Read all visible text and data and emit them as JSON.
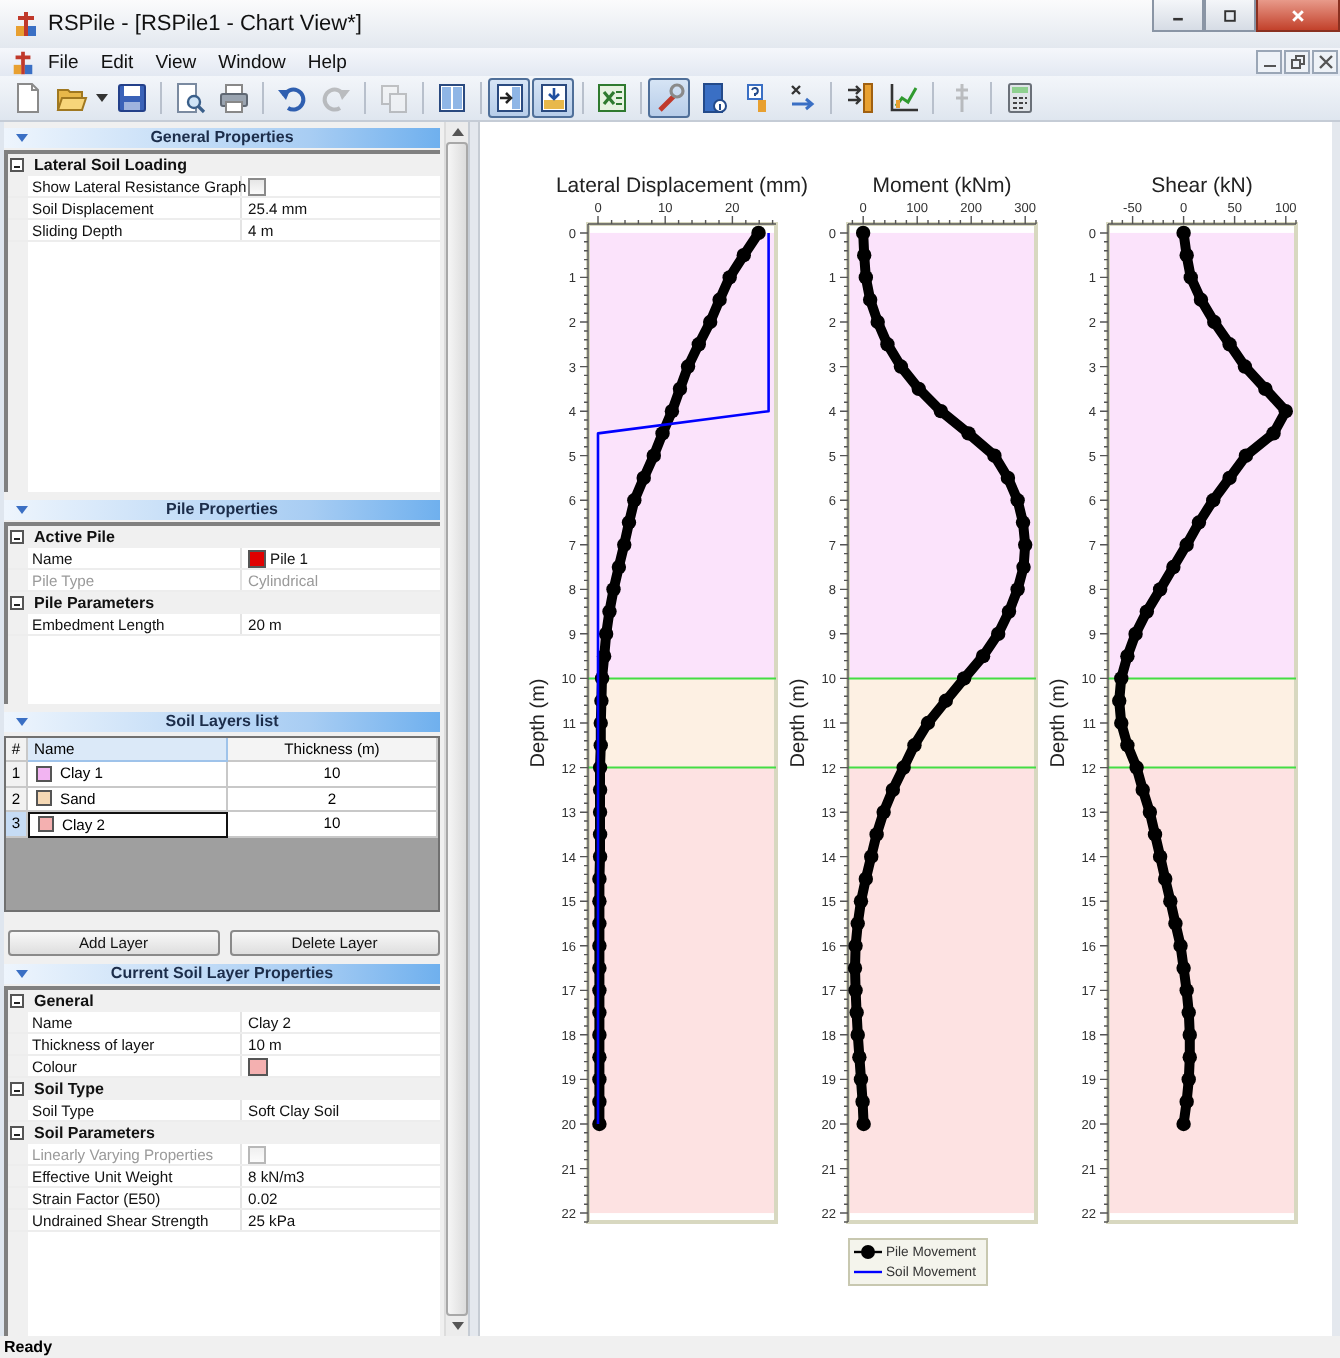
{
  "window": {
    "title": "RSPile - [RSPile1 - Chart View*]"
  },
  "menu": [
    "File",
    "Edit",
    "View",
    "Window",
    "Help"
  ],
  "toolbar": [
    {
      "pressed": false,
      "disabled": false
    },
    {
      "pressed": false,
      "disabled": false
    },
    {
      "pressed": false,
      "disabled": false
    },
    {
      "pressed": false,
      "disabled": false
    },
    {
      "pressed": false,
      "disabled": false
    },
    {
      "pressed": false,
      "disabled": false
    },
    {
      "pressed": false,
      "disabled": true
    },
    {
      "pressed": false,
      "disabled": true
    },
    {
      "pressed": false,
      "disabled": false
    },
    {
      "pressed": true,
      "disabled": false
    },
    {
      "pressed": true,
      "disabled": false
    },
    {
      "pressed": false,
      "disabled": false
    },
    {
      "pressed": true,
      "disabled": false
    },
    {
      "pressed": false,
      "disabled": false
    },
    {
      "pressed": false,
      "disabled": false
    },
    {
      "pressed": false,
      "disabled": false
    },
    {
      "pressed": false,
      "disabled": false
    },
    {
      "pressed": false,
      "disabled": false
    },
    {
      "pressed": false,
      "disabled": true
    },
    {
      "pressed": false,
      "disabled": false
    }
  ],
  "left_panel": [
    {
      "kind": "properties",
      "title": "General Properties",
      "categories": [
        {
          "name": "Lateral Soil Loading",
          "expanded": true,
          "rows": [
            {
              "kind": "checkbox",
              "label": "Show Lateral Resistance Graph",
              "checked": false,
              "disabled": false
            },
            {
              "kind": "text",
              "label": "Soil Displacement",
              "value": "25.4 mm",
              "disabled": false
            },
            {
              "kind": "text",
              "label": "Sliding Depth",
              "value": "4 m",
              "disabled": false
            }
          ]
        }
      ]
    },
    {
      "kind": "properties",
      "title": "Pile Properties",
      "categories": [
        {
          "name": "Active Pile",
          "expanded": true,
          "rows": [
            {
              "kind": "swatch_text",
              "label": "Name",
              "value": "Pile 1",
              "color": "#e00000",
              "disabled": false
            },
            {
              "kind": "text",
              "label": "Pile Type",
              "value": "Cylindrical",
              "disabled": true
            }
          ]
        },
        {
          "name": "Pile Parameters",
          "expanded": true,
          "rows": [
            {
              "kind": "text",
              "label": "Embedment Length",
              "value": "20 m",
              "disabled": false
            }
          ]
        }
      ]
    },
    {
      "kind": "table",
      "title": "Soil Layers list",
      "columns": [
        {
          "label": "#",
          "selected": false
        },
        {
          "label": "Name",
          "selected": true
        },
        {
          "label": "Thickness (m)",
          "selected": false
        }
      ],
      "rows": [
        {
          "index": "1",
          "name": "Clay 1",
          "thickness": "10",
          "color": "#f2b4f2",
          "selected": false
        },
        {
          "index": "2",
          "name": "Sand",
          "thickness": "2",
          "color": "#f5d8b4",
          "selected": false
        },
        {
          "index": "3",
          "name": "Clay 2",
          "thickness": "10",
          "color": "#f4b0b0",
          "selected": true
        }
      ]
    },
    {
      "kind": "buttons",
      "buttons": [
        "Add Layer",
        "Delete Layer"
      ]
    },
    {
      "kind": "properties",
      "title": "Current Soil Layer Properties",
      "categories": [
        {
          "name": "General",
          "expanded": true,
          "rows": [
            {
              "kind": "text",
              "label": "Name",
              "value": "Clay 2",
              "disabled": false
            },
            {
              "kind": "text",
              "label": "Thickness of layer",
              "value": "10 m",
              "disabled": false
            },
            {
              "kind": "swatch",
              "label": "Colour",
              "color": "#f4b0b0",
              "disabled": false
            }
          ]
        },
        {
          "name": "Soil Type",
          "expanded": true,
          "rows": [
            {
              "kind": "text",
              "label": "Soil Type",
              "value": "Soft Clay Soil",
              "disabled": false
            }
          ]
        },
        {
          "name": "Soil Parameters",
          "expanded": true,
          "rows": [
            {
              "kind": "checkbox",
              "label": "Linearly Varying Properties",
              "checked": false,
              "disabled": true
            },
            {
              "kind": "text",
              "label": "Effective Unit Weight",
              "value": "8 kN/m3",
              "disabled": false
            },
            {
              "kind": "text",
              "label": "Strain Factor (E50)",
              "value": "0.02",
              "disabled": false
            },
            {
              "kind": "text",
              "label": "Undrained Shear Strength",
              "value": "25 kPa",
              "disabled": false
            }
          ]
        }
      ]
    }
  ],
  "charts": [
    {
      "chart_data": {
        "type": "line",
        "orientation": "horizontal",
        "title": "Lateral Displacement (mm)",
        "ylabel": "Depth (m)",
        "x": [
          0,
          0.5,
          1,
          1.5,
          2,
          2.5,
          3,
          3.5,
          4,
          4.5,
          5,
          5.5,
          6,
          6.5,
          7,
          7.5,
          8,
          8.5,
          9,
          9.5,
          10,
          10.5,
          11,
          11.5,
          12,
          12.5,
          13,
          13.5,
          14,
          14.5,
          15,
          15.5,
          16,
          16.5,
          17,
          17.5,
          18,
          18.5,
          19,
          19.5,
          20
        ],
        "xlim": [
          -1.5,
          26.5
        ],
        "xticks": [
          0,
          10,
          20
        ],
        "ylim": [
          22.2,
          -0.2
        ],
        "bands": [
          {
            "axis": "y",
            "from": 0,
            "to": 10,
            "color": "#fbe3fb"
          },
          {
            "axis": "y",
            "from": 10,
            "to": 12,
            "color": "#fdf0e3"
          },
          {
            "axis": "y",
            "from": 12,
            "to": 22,
            "color": "#fde2e2"
          }
        ],
        "ref_lines": [
          {
            "axis": "y",
            "value": 10,
            "color": "#44dd44"
          },
          {
            "axis": "y",
            "value": 12,
            "color": "#44dd44"
          }
        ],
        "yticks": [
          0,
          1,
          2,
          3,
          4,
          5,
          6,
          7,
          8,
          9,
          10,
          11,
          12,
          13,
          14,
          15,
          16,
          17,
          18,
          19,
          20,
          21,
          22
        ],
        "series": [
          {
            "name": "Pile Movement",
            "color": "#000000",
            "marker": "circle",
            "values": [
              23.9,
              21.7,
              19.6,
              18.1,
              16.7,
              15.0,
              13.4,
              12.2,
              11.0,
              9.6,
              8.3,
              6.8,
              5.4,
              4.6,
              3.9,
              3.1,
              2.3,
              1.7,
              1.2,
              0.9,
              0.6,
              0.5,
              0.4,
              0.4,
              0.3,
              0.3,
              0.3,
              0.3,
              0.3,
              0.2,
              0.2,
              0.2,
              0.2,
              0.2,
              0.2,
              0.2,
              0.2,
              0.2,
              0.2,
              0.2,
              0.2
            ]
          },
          {
            "name": "Soil Movement",
            "color": "#0000ff",
            "values": [
              25.4,
              25.4,
              25.4,
              25.4,
              25.4,
              25.4,
              25.4,
              25.4,
              25.4,
              0,
              0,
              0,
              0,
              0,
              0,
              0,
              0,
              0,
              0,
              0,
              0,
              0,
              0,
              0,
              0,
              0,
              0,
              0,
              0,
              0,
              0,
              0,
              0,
              0,
              0,
              0,
              0,
              0,
              0,
              0,
              0
            ]
          }
        ]
      }
    },
    {
      "chart_data": {
        "type": "line",
        "orientation": "horizontal",
        "title": "Moment (kNm)",
        "ylabel": "Depth (m)",
        "x": [
          0,
          0.5,
          1,
          1.5,
          2,
          2.5,
          3,
          3.5,
          4,
          4.5,
          5,
          5.5,
          6,
          6.5,
          7,
          7.5,
          8,
          8.5,
          9,
          9.5,
          10,
          10.5,
          11,
          11.5,
          12,
          12.5,
          13,
          13.5,
          14,
          14.5,
          15,
          15.5,
          16,
          16.5,
          17,
          17.5,
          18,
          18.5,
          19,
          19.5,
          20
        ],
        "xlim": [
          -28,
          320
        ],
        "xticks": [
          0,
          100,
          200,
          300
        ],
        "ylim": [
          22.2,
          -0.2
        ],
        "bands": [
          {
            "axis": "y",
            "from": 0,
            "to": 10,
            "color": "#fbe3fb"
          },
          {
            "axis": "y",
            "from": 10,
            "to": 12,
            "color": "#fdf0e3"
          },
          {
            "axis": "y",
            "from": 12,
            "to": 22,
            "color": "#fde2e2"
          }
        ],
        "ref_lines": [
          {
            "axis": "y",
            "value": 10,
            "color": "#44dd44"
          },
          {
            "axis": "y",
            "value": 12,
            "color": "#44dd44"
          }
        ],
        "yticks": [
          0,
          1,
          2,
          3,
          4,
          5,
          6,
          7,
          8,
          9,
          10,
          11,
          12,
          13,
          14,
          15,
          16,
          17,
          18,
          19,
          20,
          21,
          22
        ],
        "series": [
          {
            "color": "#000000",
            "marker": "circle",
            "values": [
              0,
              2,
              5,
              13,
              27,
              45,
              70,
              103,
              144,
              195,
              243,
              268,
              286,
              296,
              300,
              297,
              286,
              270,
              250,
              222,
              187,
              153,
              120,
              95,
              75,
              55,
              38,
              25,
              15,
              5,
              -4,
              -10,
              -14,
              -15,
              -14,
              -12,
              -10,
              -7,
              -4,
              -1,
              1
            ]
          }
        ]
      }
    },
    {
      "chart_data": {
        "type": "line",
        "orientation": "horizontal",
        "title": "Shear (kN)",
        "ylabel": "Depth (m)",
        "x": [
          0,
          0.5,
          1,
          1.5,
          2,
          2.5,
          3,
          3.5,
          4,
          4.5,
          5,
          5.5,
          6,
          6.5,
          7,
          7.5,
          8,
          8.5,
          9,
          9.5,
          10,
          10.5,
          11,
          11.5,
          12,
          12.5,
          13,
          13.5,
          14,
          14.5,
          15,
          15.5,
          16,
          16.5,
          17,
          17.5,
          18,
          18.5,
          19,
          19.5,
          20
        ],
        "xlim": [
          -74,
          110
        ],
        "xticks": [
          -50,
          0,
          50,
          100
        ],
        "ylim": [
          22.2,
          -0.2
        ],
        "bands": [
          {
            "axis": "y",
            "from": 0,
            "to": 10,
            "color": "#fbe3fb"
          },
          {
            "axis": "y",
            "from": 10,
            "to": 12,
            "color": "#fdf0e3"
          },
          {
            "axis": "y",
            "from": 12,
            "to": 22,
            "color": "#fde2e2"
          }
        ],
        "ref_lines": [
          {
            "axis": "y",
            "value": 10,
            "color": "#44dd44"
          },
          {
            "axis": "y",
            "value": 12,
            "color": "#44dd44"
          }
        ],
        "yticks": [
          0,
          1,
          2,
          3,
          4,
          5,
          6,
          7,
          8,
          9,
          10,
          11,
          12,
          13,
          14,
          15,
          16,
          17,
          18,
          19,
          20,
          21,
          22
        ],
        "series": [
          {
            "color": "#000000",
            "marker": "circle",
            "values": [
              0,
              3,
              7,
              17,
              30,
              45,
              60,
              80,
              100,
              88,
              61,
              45,
              29,
              15,
              3,
              -10,
              -23,
              -36,
              -47,
              -55,
              -61,
              -63,
              -61,
              -55,
              -46,
              -40,
              -33,
              -28,
              -23,
              -18,
              -13,
              -8,
              -3,
              0,
              3,
              5,
              6,
              6,
              5,
              3,
              0
            ]
          }
        ]
      }
    }
  ],
  "status_bar": "Ready"
}
